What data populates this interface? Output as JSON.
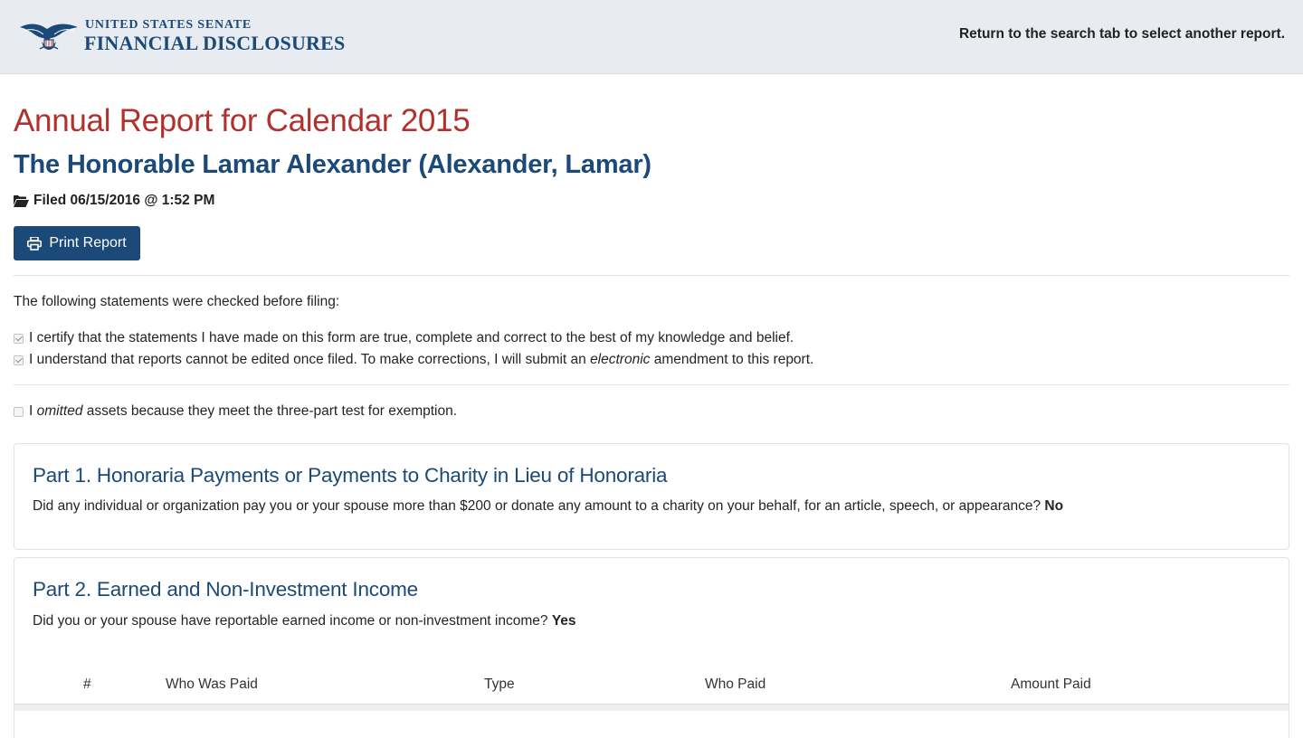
{
  "header": {
    "logo_line1": "UNITED STATES SENATE",
    "logo_line2": "FINANCIAL DISCLOSURES",
    "return_link": "Return to the search tab to select another report."
  },
  "report": {
    "title": "Annual Report for Calendar 2015",
    "member": "The Honorable Lamar Alexander (Alexander, Lamar)",
    "filed": "Filed 06/15/2016 @ 1:52 PM",
    "print_label": "Print Report"
  },
  "statements": {
    "intro": "The following statements were checked before filing:",
    "certify": "I certify that the statements I have made on this form are true, complete and correct to the best of my knowledge and belief.",
    "understand_pre": "I understand that reports cannot be edited once filed. To make corrections, I will submit an ",
    "understand_em": "electronic",
    "understand_post": " amendment to this report.",
    "omitted_pre": "I ",
    "omitted_em": "omitted",
    "omitted_post": " assets because they meet the three-part test for exemption."
  },
  "part1": {
    "title": "Part 1. Honoraria Payments or Payments to Charity in Lieu of Honoraria",
    "question": "Did any individual or organization pay you or your spouse more than $200 or donate any amount to a charity on your behalf, for an article, speech, or appearance? ",
    "answer": "No"
  },
  "part2": {
    "title": "Part 2. Earned and Non-Investment Income",
    "question": "Did you or your spouse have reportable earned income or non-investment income? ",
    "answer": "Yes",
    "columns": [
      "#",
      "Who Was Paid",
      "Type",
      "Who Paid",
      "Amount Paid"
    ]
  },
  "colors": {
    "brand_blue": "#1b4a78",
    "title_red": "#b0322e",
    "header_bg": "#e8ecf0"
  }
}
